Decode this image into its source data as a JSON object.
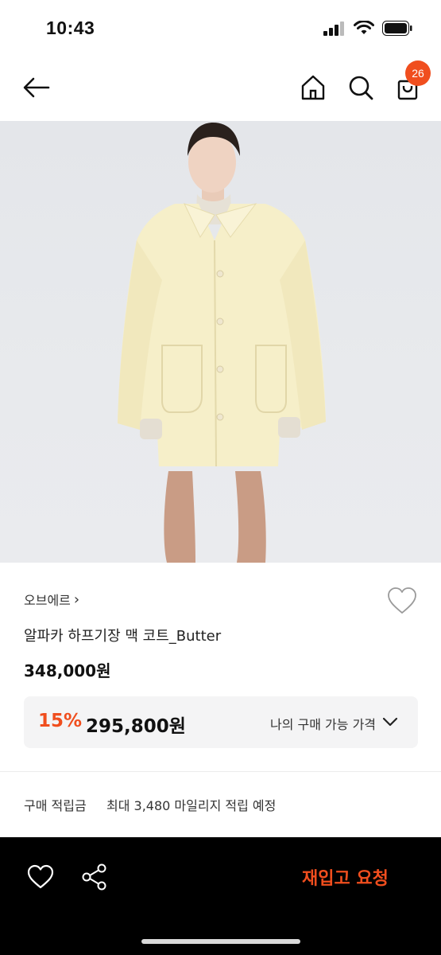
{
  "status_bar": {
    "time": "10:43"
  },
  "nav": {
    "cart_count": "26",
    "icons": [
      "back-arrow-icon",
      "home-icon",
      "search-icon",
      "cart-icon"
    ]
  },
  "product": {
    "brand": "오브에르",
    "brand_chevron": "›",
    "name": "알파카 하프기장 맥 코트_Butter",
    "original_price": "348,000원",
    "discount_percent": "15%",
    "discount_price": "295,800원",
    "my_price_label": "나의 구매 가능 가격"
  },
  "points": {
    "label": "구매 적립금",
    "value": "최대 3,480 마일리지 적립 예정"
  },
  "bottom_bar": {
    "cta_label": "재입고 요청"
  },
  "colors": {
    "accent": "#f04e1e",
    "bottom_bar_bg": "#000000",
    "price_box_bg": "#f4f4f5",
    "coat": "#f6efc9"
  }
}
